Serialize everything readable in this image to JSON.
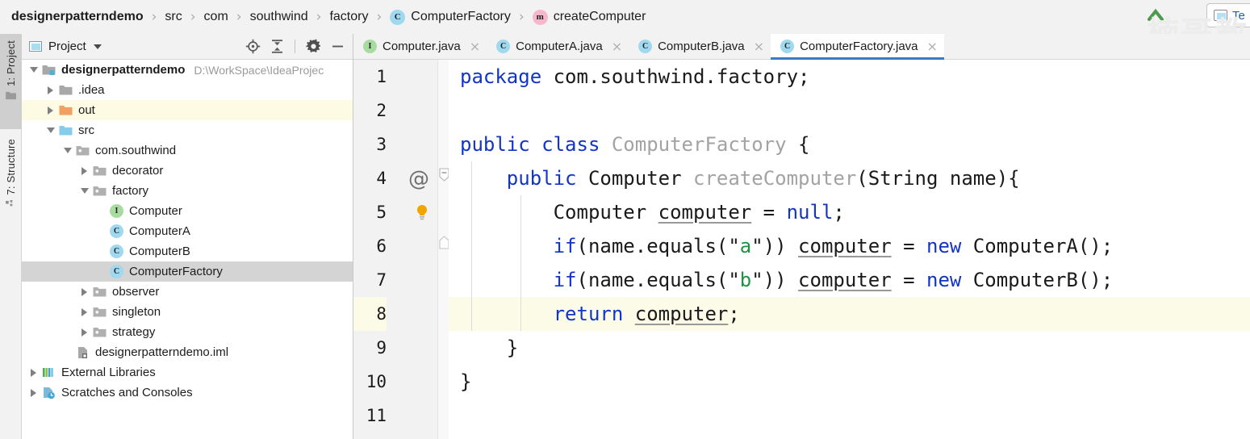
{
  "breadcrumb": {
    "items": [
      {
        "label": "designerpatterndemo",
        "icon": "none",
        "bold": true
      },
      {
        "label": "src",
        "icon": "none",
        "bold": false
      },
      {
        "label": "com",
        "icon": "none",
        "bold": false
      },
      {
        "label": "southwind",
        "icon": "none",
        "bold": false
      },
      {
        "label": "factory",
        "icon": "none",
        "bold": false
      },
      {
        "label": "ComputerFactory",
        "icon": "class-icon",
        "bold": false
      },
      {
        "label": "createComputer",
        "icon": "method-icon",
        "bold": false
      }
    ],
    "separator": "›"
  },
  "topright": {
    "chevron_icon": "chevron-up-icon",
    "panel_button_label": "Te",
    "panel_button_icon": "tool-window-icon",
    "watermark_text": "楠哥教"
  },
  "tool_strip": {
    "tabs": [
      {
        "label": "1: Project",
        "icon": "folder-icon",
        "active": true
      },
      {
        "label": "7: Structure",
        "icon": "structure-icon",
        "active": false
      }
    ]
  },
  "project_panel": {
    "title": "Project",
    "title_icon": "project-window-icon",
    "caret_icon": "chevron-down-icon",
    "tools": [
      {
        "name": "locate-icon",
        "label": "Select Opened File"
      },
      {
        "name": "collapse-all-icon",
        "label": "Collapse All"
      },
      {
        "name": "gear-icon",
        "label": "Settings"
      },
      {
        "name": "minimize-icon",
        "label": "Hide"
      }
    ],
    "tree": [
      {
        "depth": 0,
        "twist": "down",
        "icon": "module-folder-icon",
        "label": "designerpatterndemo",
        "bold": true,
        "path": "D:\\WorkSpace\\IdeaProjec",
        "row": "normal"
      },
      {
        "depth": 1,
        "twist": "right",
        "icon": "folder-gray-icon",
        "label": ".idea",
        "bold": false,
        "path": "",
        "row": "normal"
      },
      {
        "depth": 1,
        "twist": "right",
        "icon": "folder-orange-icon",
        "label": "out",
        "bold": false,
        "path": "",
        "row": "yellow"
      },
      {
        "depth": 1,
        "twist": "down",
        "icon": "folder-blue-icon",
        "label": "src",
        "bold": false,
        "path": "",
        "row": "normal"
      },
      {
        "depth": 2,
        "twist": "down",
        "icon": "package-icon",
        "label": "com.southwind",
        "bold": false,
        "path": "",
        "row": "normal"
      },
      {
        "depth": 3,
        "twist": "right",
        "icon": "package-icon",
        "label": "decorator",
        "bold": false,
        "path": "",
        "row": "normal"
      },
      {
        "depth": 3,
        "twist": "down",
        "icon": "package-icon",
        "label": "factory",
        "bold": false,
        "path": "",
        "row": "normal"
      },
      {
        "depth": 4,
        "twist": "none",
        "icon": "interface-icon",
        "label": "Computer",
        "bold": false,
        "path": "",
        "row": "normal"
      },
      {
        "depth": 4,
        "twist": "none",
        "icon": "class-icon",
        "label": "ComputerA",
        "bold": false,
        "path": "",
        "row": "normal"
      },
      {
        "depth": 4,
        "twist": "none",
        "icon": "class-icon",
        "label": "ComputerB",
        "bold": false,
        "path": "",
        "row": "normal"
      },
      {
        "depth": 4,
        "twist": "none",
        "icon": "class-icon",
        "label": "ComputerFactory",
        "bold": false,
        "path": "",
        "row": "selected"
      },
      {
        "depth": 3,
        "twist": "right",
        "icon": "package-icon",
        "label": "observer",
        "bold": false,
        "path": "",
        "row": "normal"
      },
      {
        "depth": 3,
        "twist": "right",
        "icon": "package-icon",
        "label": "singleton",
        "bold": false,
        "path": "",
        "row": "normal"
      },
      {
        "depth": 3,
        "twist": "right",
        "icon": "package-icon",
        "label": "strategy",
        "bold": false,
        "path": "",
        "row": "normal"
      },
      {
        "depth": 2,
        "twist": "none",
        "icon": "iml-file-icon",
        "label": "designerpatterndemo.iml",
        "bold": false,
        "path": "",
        "row": "normal"
      },
      {
        "depth": 0,
        "twist": "right",
        "icon": "libraries-icon",
        "label": "External Libraries",
        "bold": false,
        "path": "",
        "row": "normal"
      },
      {
        "depth": 0,
        "twist": "right",
        "icon": "scratches-icon",
        "label": "Scratches and Consoles",
        "bold": false,
        "path": "",
        "row": "normal"
      }
    ]
  },
  "editor": {
    "tabs": [
      {
        "label": "Computer.java",
        "icon": "interface-icon",
        "active": false,
        "close": "×"
      },
      {
        "label": "ComputerA.java",
        "icon": "class-icon",
        "active": false,
        "close": "×"
      },
      {
        "label": "ComputerB.java",
        "icon": "class-icon",
        "active": false,
        "close": "×"
      },
      {
        "label": "ComputerFactory.java",
        "icon": "class-icon",
        "active": true,
        "close": "×"
      }
    ],
    "line_numbers": [
      "1",
      "2",
      "3",
      "4",
      "5",
      "6",
      "7",
      "8",
      "9",
      "10",
      "11"
    ],
    "gutter_markers": [
      {
        "line": 4,
        "type": "annotation-marker",
        "glyph": "@"
      },
      {
        "line": 4,
        "type": "fold-arrow-icon",
        "glyph": ""
      },
      {
        "line": 8,
        "type": "intention-bulb-icon",
        "glyph": ""
      },
      {
        "line": 9,
        "type": "fold-end-icon",
        "glyph": ""
      }
    ],
    "code": [
      {
        "n": 1,
        "highlight": false,
        "tokens": [
          {
            "t": "package ",
            "c": "kw"
          },
          {
            "t": "com.southwind.factory;",
            "c": "plain"
          }
        ]
      },
      {
        "n": 2,
        "highlight": false,
        "tokens": []
      },
      {
        "n": 3,
        "highlight": false,
        "tokens": [
          {
            "t": "public class ",
            "c": "kw"
          },
          {
            "t": "ComputerFactory",
            "c": "cls-name"
          },
          {
            "t": " {",
            "c": "plain"
          }
        ]
      },
      {
        "n": 4,
        "highlight": false,
        "tokens": [
          {
            "t": "    ",
            "c": "plain"
          },
          {
            "t": "public ",
            "c": "kw"
          },
          {
            "t": "Computer ",
            "c": "plain"
          },
          {
            "t": "createComputer",
            "c": "method-name"
          },
          {
            "t": "(String name){",
            "c": "plain"
          }
        ]
      },
      {
        "n": 5,
        "highlight": false,
        "tokens": [
          {
            "t": "        Computer ",
            "c": "plain"
          },
          {
            "t": "computer",
            "c": "localvar"
          },
          {
            "t": " = ",
            "c": "plain"
          },
          {
            "t": "null",
            "c": "kw"
          },
          {
            "t": ";",
            "c": "plain"
          }
        ]
      },
      {
        "n": 6,
        "highlight": false,
        "tokens": [
          {
            "t": "        ",
            "c": "plain"
          },
          {
            "t": "if",
            "c": "kw"
          },
          {
            "t": "(name.equals(\"",
            "c": "plain"
          },
          {
            "t": "a",
            "c": "str"
          },
          {
            "t": "\")) ",
            "c": "plain"
          },
          {
            "t": "computer",
            "c": "localvar"
          },
          {
            "t": " = ",
            "c": "plain"
          },
          {
            "t": "new",
            "c": "kw"
          },
          {
            "t": " ComputerA();",
            "c": "plain"
          }
        ]
      },
      {
        "n": 7,
        "highlight": false,
        "tokens": [
          {
            "t": "        ",
            "c": "plain"
          },
          {
            "t": "if",
            "c": "kw"
          },
          {
            "t": "(name.equals(\"",
            "c": "plain"
          },
          {
            "t": "b",
            "c": "str"
          },
          {
            "t": "\")) ",
            "c": "plain"
          },
          {
            "t": "computer",
            "c": "localvar"
          },
          {
            "t": " = ",
            "c": "plain"
          },
          {
            "t": "new",
            "c": "kw"
          },
          {
            "t": " ComputerB();",
            "c": "plain"
          }
        ]
      },
      {
        "n": 8,
        "highlight": true,
        "tokens": [
          {
            "t": "        ",
            "c": "plain"
          },
          {
            "t": "return",
            "c": "kw"
          },
          {
            "t": " ",
            "c": "plain"
          },
          {
            "t": "computer",
            "c": "localvar"
          },
          {
            "t": ";",
            "c": "plain"
          }
        ]
      },
      {
        "n": 9,
        "highlight": false,
        "tokens": [
          {
            "t": "    }",
            "c": "plain"
          }
        ]
      },
      {
        "n": 10,
        "highlight": false,
        "tokens": [
          {
            "t": "}",
            "c": "plain"
          }
        ]
      },
      {
        "n": 11,
        "highlight": false,
        "tokens": []
      }
    ]
  },
  "colors": {
    "keyword": "#1335c6",
    "string": "#1a9641",
    "class_ref": "#a3a3a3",
    "highlight_line": "#fbfbe8",
    "tab_underline": "#3a7cc4",
    "folder_orange": "#f0a060",
    "folder_blue": "#85cdea",
    "bulb": "#f0a500"
  }
}
